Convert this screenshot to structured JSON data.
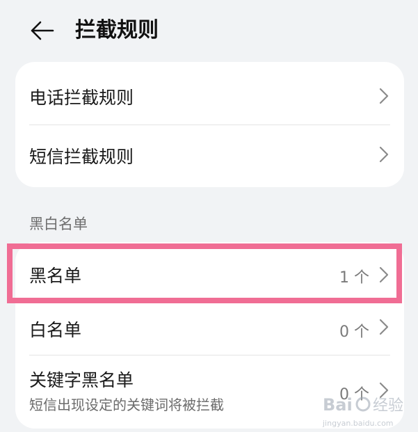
{
  "header": {
    "title": "拦截规则",
    "back_icon": "arrow-left-icon"
  },
  "rules": {
    "items": [
      {
        "label": "电话拦截规则"
      },
      {
        "label": "短信拦截规则"
      }
    ]
  },
  "lists": {
    "section_title": "黑白名单",
    "items": [
      {
        "label": "黑名单",
        "value": "1 个"
      },
      {
        "label": "白名单",
        "value": "0 个"
      },
      {
        "label": "关键字黑名单",
        "subtitle": "短信出现设定的关键词将被拦截",
        "value": "0 个"
      }
    ]
  },
  "highlight": {
    "color": "#f06d94"
  },
  "watermark": {
    "text": "Baidu 经验",
    "subtext": "jingyan.baidu.com"
  }
}
